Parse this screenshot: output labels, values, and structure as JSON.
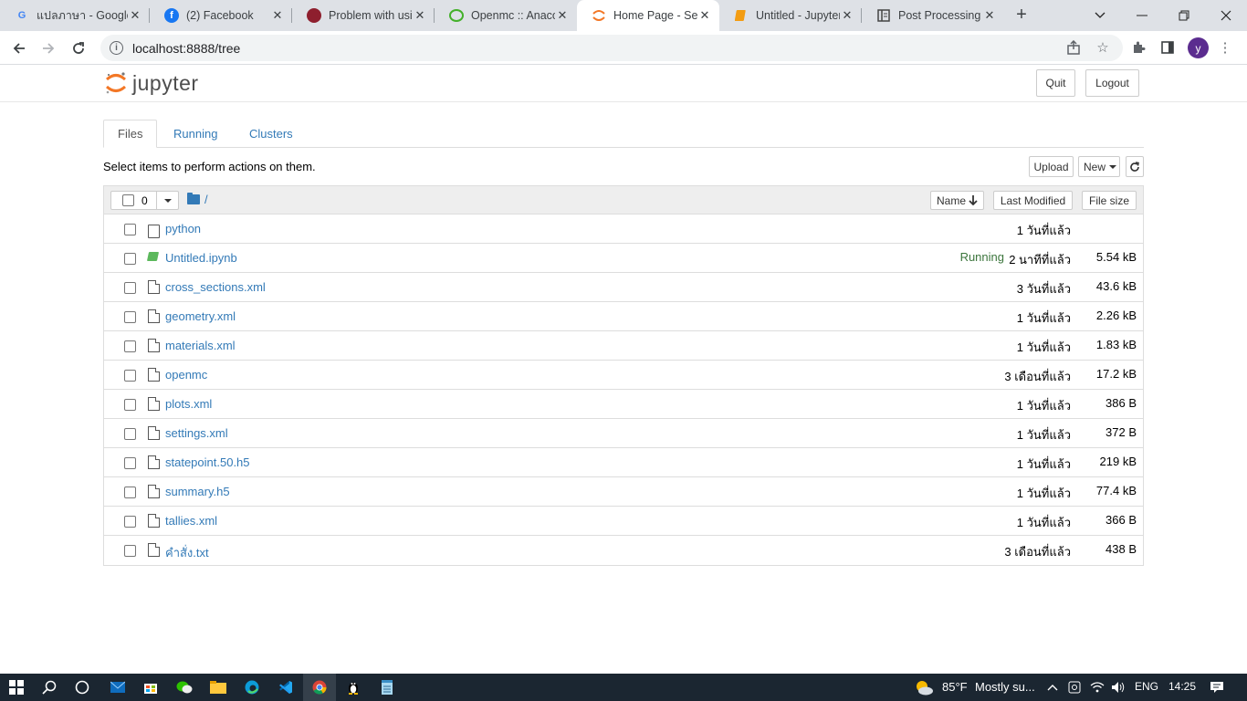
{
  "browser": {
    "tabs": [
      {
        "title": "แปลภาษา - Google แปลภาษา",
        "icon": "google-icon"
      },
      {
        "title": "(2) Facebook",
        "icon": "facebook-icon"
      },
      {
        "title": "Problem with using OpenMC",
        "icon": "discourse-icon"
      },
      {
        "title": "Openmc :: Anaconda.org",
        "icon": "anaconda-icon"
      },
      {
        "title": "Home Page - Select or create a notebook",
        "icon": "jupyter-icon",
        "active": true
      },
      {
        "title": "Untitled - Jupyter Notebook",
        "icon": "notebook-icon"
      },
      {
        "title": "Post Processing — OpenMC",
        "icon": "doc-icon"
      }
    ],
    "url": "localhost:8888/tree",
    "profile_initial": "y"
  },
  "jupyter": {
    "logo_text": "jupyter",
    "quit_label": "Quit",
    "logout_label": "Logout",
    "tabs": [
      "Files",
      "Running",
      "Clusters"
    ],
    "hint": "Select items to perform actions on them.",
    "upload_label": "Upload",
    "new_label": "New",
    "selected_count": "0",
    "breadcrumb": "/",
    "columns": {
      "name": "Name",
      "modified": "Last Modified",
      "size": "File size"
    },
    "files": [
      {
        "name": "python",
        "type": "folder",
        "modified": "1 วันที่แล้ว",
        "size": "",
        "status": ""
      },
      {
        "name": "Untitled.ipynb",
        "type": "notebook",
        "modified": "2 นาทีที่แล้ว",
        "size": "5.54 kB",
        "status": "Running"
      },
      {
        "name": "cross_sections.xml",
        "type": "file",
        "modified": "3 วันที่แล้ว",
        "size": "43.6 kB",
        "status": ""
      },
      {
        "name": "geometry.xml",
        "type": "file",
        "modified": "1 วันที่แล้ว",
        "size": "2.26 kB",
        "status": ""
      },
      {
        "name": "materials.xml",
        "type": "file",
        "modified": "1 วันที่แล้ว",
        "size": "1.83 kB",
        "status": ""
      },
      {
        "name": "openmc",
        "type": "file",
        "modified": "3 เดือนที่แล้ว",
        "size": "17.2 kB",
        "status": ""
      },
      {
        "name": "plots.xml",
        "type": "file",
        "modified": "1 วันที่แล้ว",
        "size": "386 B",
        "status": ""
      },
      {
        "name": "settings.xml",
        "type": "file",
        "modified": "1 วันที่แล้ว",
        "size": "372 B",
        "status": ""
      },
      {
        "name": "statepoint.50.h5",
        "type": "file",
        "modified": "1 วันที่แล้ว",
        "size": "219 kB",
        "status": ""
      },
      {
        "name": "summary.h5",
        "type": "file",
        "modified": "1 วันที่แล้ว",
        "size": "77.4 kB",
        "status": ""
      },
      {
        "name": "tallies.xml",
        "type": "file",
        "modified": "1 วันที่แล้ว",
        "size": "366 B",
        "status": ""
      },
      {
        "name": "คำสั่ง.txt",
        "type": "file",
        "modified": "3 เดือนที่แล้ว",
        "size": "438 B",
        "status": ""
      }
    ]
  },
  "taskbar": {
    "weather_temp": "85°F",
    "weather_text": "Mostly su...",
    "language": "ENG",
    "time": "14:25"
  }
}
